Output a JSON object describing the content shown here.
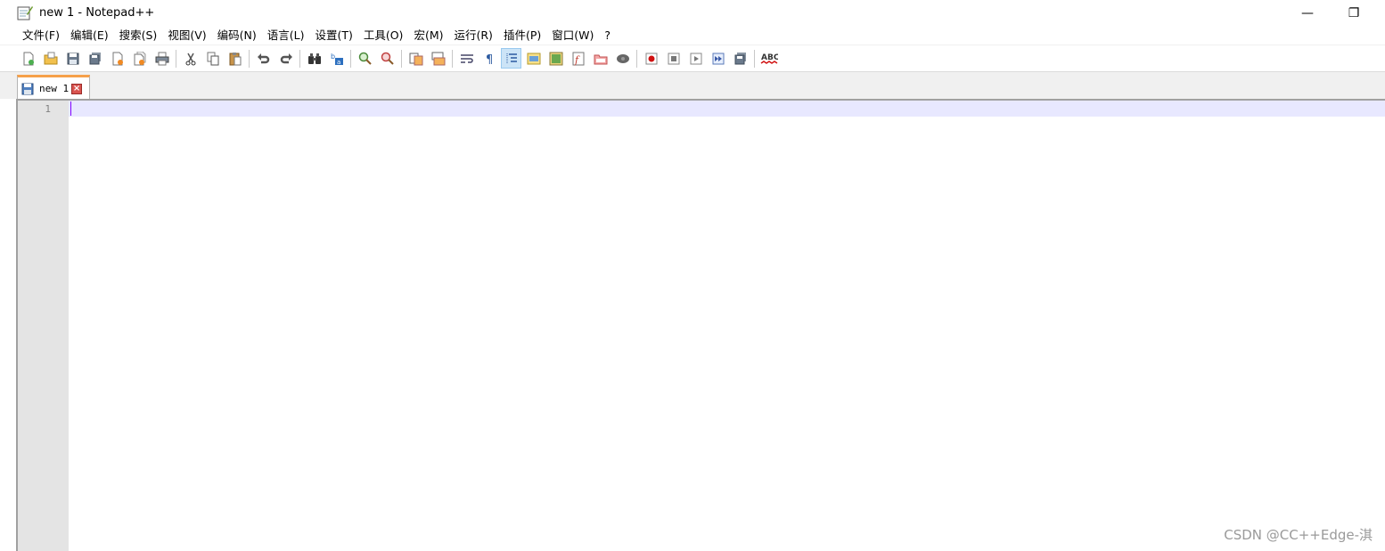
{
  "window": {
    "title": "new 1 - Notepad++",
    "minimize_glyph": "—",
    "restore_glyph": "❐"
  },
  "menu": [
    "文件(F)",
    "编辑(E)",
    "搜索(S)",
    "视图(V)",
    "编码(N)",
    "语言(L)",
    "设置(T)",
    "工具(O)",
    "宏(M)",
    "运行(R)",
    "插件(P)",
    "窗口(W)",
    "?"
  ],
  "toolbar": {
    "spellcheck_label": "ABC"
  },
  "tab": {
    "label": "new 1",
    "close_glyph": "×"
  },
  "editor": {
    "line_number": "1"
  },
  "watermark": "CSDN @CC++Edge-淇",
  "colors": {
    "accent_tab": "#f6a04a",
    "current_line": "#e8e8ff",
    "caret": "#8000ff"
  }
}
